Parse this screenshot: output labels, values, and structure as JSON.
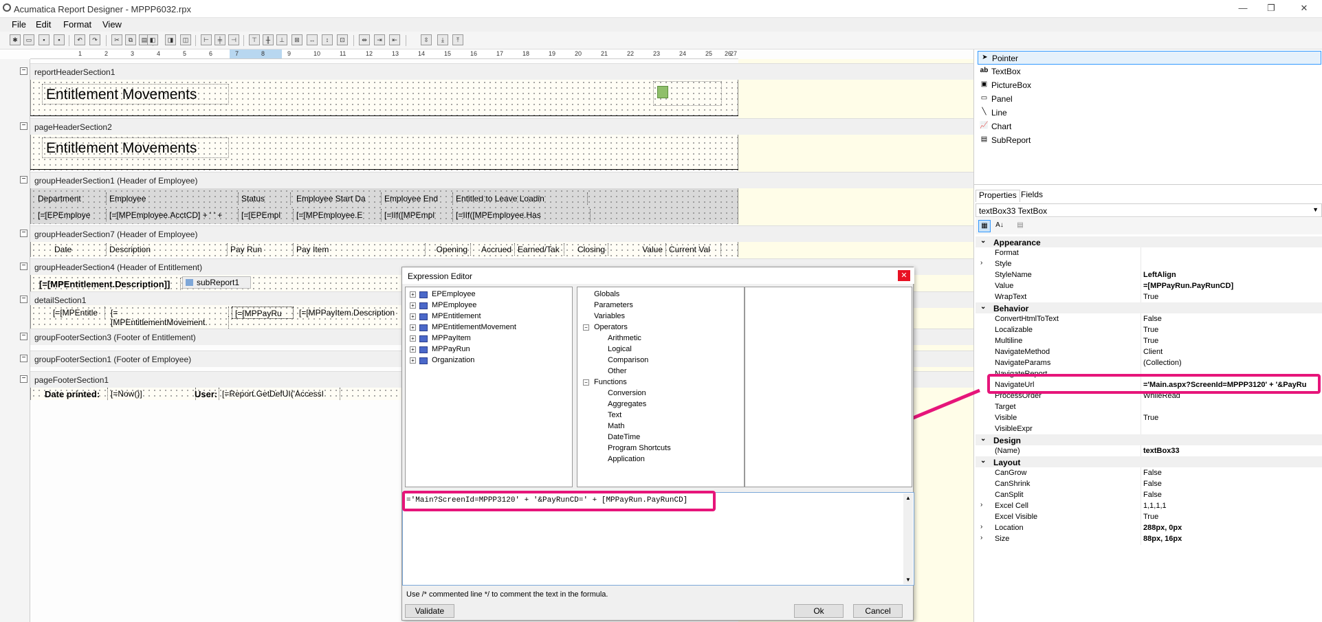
{
  "window": {
    "title": "Acumatica Report Designer - MPPP6032.rpx"
  },
  "menu": [
    "File",
    "Edit",
    "Format",
    "View"
  ],
  "ruler": [
    "1",
    "2",
    "3",
    "4",
    "5",
    "6",
    "7",
    "8",
    "9",
    "10",
    "11",
    "12",
    "13",
    "14",
    "15",
    "16",
    "17",
    "18",
    "19",
    "20",
    "21",
    "22",
    "23",
    "24",
    "25",
    "26",
    "27"
  ],
  "sections": {
    "s1": "reportHeaderSection1",
    "s2": "pageHeaderSection2",
    "s3": "groupHeaderSection1 (Header of Employee)",
    "s4": "groupHeaderSection7 (Header of Employee)",
    "s5": "groupHeaderSection4 (Header of Entitlement)",
    "s6": "detailSection1",
    "s7": "groupFooterSection3 (Footer of Entitlement)",
    "s8": "groupFooterSection1 (Footer of Employee)",
    "s9": "pageFooterSection1"
  },
  "report": {
    "title1": "Entitlement Movements",
    "title2": "Entitlement Movements",
    "hdr": [
      "Department",
      "Employee",
      "Status",
      "Employee Start Da",
      "Employee End",
      "Entitled to Leave Loadin"
    ],
    "hdrvals": [
      "[=[EPEmploye",
      "[=[MPEmployee.AcctCD] + ' ' +",
      "[=[EPEmpl",
      "[=[MPEmployee.E",
      "[=IIf([MPEmpl",
      "[=IIf([MPEmployee.Has"
    ],
    "cols": [
      "Date",
      "Description",
      "Pay Run",
      "Pay Item",
      "Opening",
      "Accrued",
      "Earned/Tak",
      "Closing",
      "Value",
      "Current Val"
    ],
    "ent_desc": "[=[MPEntitlement.Description]]",
    "subreport": "subReport1",
    "detail": [
      "[=[MPEntitle",
      "[=",
      "[MPEntitlementMovement.",
      "[=[MPPayRu",
      "[=[MPPayItem.Description"
    ],
    "footer": {
      "date_label": "Date printed:",
      "date_val": "[=Now()]",
      "user_label": "User:",
      "user_val": "[=Report.GetDefUI('AccessI"
    }
  },
  "toolbox": [
    {
      "icon": "pointer-icon",
      "label": "Pointer"
    },
    {
      "icon": "textbox-icon",
      "label": "TextBox"
    },
    {
      "icon": "picturebox-icon",
      "label": "PictureBox"
    },
    {
      "icon": "panel-icon",
      "label": "Panel"
    },
    {
      "icon": "line-icon",
      "label": "Line"
    },
    {
      "icon": "chart-icon",
      "label": "Chart"
    },
    {
      "icon": "subreport-icon",
      "label": "SubReport"
    }
  ],
  "props": {
    "tabs": [
      "Properties",
      "Fields"
    ],
    "object": "textBox33 TextBox",
    "rows": [
      {
        "t": "cat",
        "n": "Appearance"
      },
      {
        "n": "Format",
        "v": ""
      },
      {
        "n": "Style",
        "v": "",
        "exp": true
      },
      {
        "n": "StyleName",
        "v": "LeftAlign",
        "b": true
      },
      {
        "n": "Value",
        "v": "=[MPPayRun.PayRunCD]",
        "b": true
      },
      {
        "n": "WrapText",
        "v": "True"
      },
      {
        "t": "cat",
        "n": "Behavior"
      },
      {
        "n": "ConvertHtmlToText",
        "v": "False"
      },
      {
        "n": "Localizable",
        "v": "True"
      },
      {
        "n": "Multiline",
        "v": "True"
      },
      {
        "n": "NavigateMethod",
        "v": "Client"
      },
      {
        "n": "NavigateParams",
        "v": "(Collection)"
      },
      {
        "n": "NavigateReport",
        "v": ""
      },
      {
        "n": "NavigateUrl",
        "v": "='Main.aspx?ScreenId=MPPP3120' + '&PayRu",
        "b": true
      },
      {
        "n": "ProcessOrder",
        "v": "WhileRead"
      },
      {
        "n": "Target",
        "v": ""
      },
      {
        "n": "Visible",
        "v": "True"
      },
      {
        "n": "VisibleExpr",
        "v": ""
      },
      {
        "t": "cat",
        "n": "Design"
      },
      {
        "n": "(Name)",
        "v": "textBox33",
        "b": true
      },
      {
        "t": "cat",
        "n": "Layout"
      },
      {
        "n": "CanGrow",
        "v": "False"
      },
      {
        "n": "CanShrink",
        "v": "False"
      },
      {
        "n": "CanSplit",
        "v": "False"
      },
      {
        "n": "Excel Cell",
        "v": "1,1,1,1",
        "exp": true
      },
      {
        "n": "Excel Visible",
        "v": "True"
      },
      {
        "n": "Location",
        "v": "288px, 0px",
        "b": true,
        "exp": true
      },
      {
        "n": "Size",
        "v": "88px, 16px",
        "b": true,
        "exp": true
      }
    ]
  },
  "dialog": {
    "title": "Expression Editor",
    "tables": [
      "EPEmployee",
      "MPEmployee",
      "MPEntitlement",
      "MPEntitlementMovement",
      "MPPayItem",
      "MPPayRun",
      "Organization"
    ],
    "tree": [
      {
        "l": "Globals",
        "d": 0
      },
      {
        "l": "Parameters",
        "d": 0
      },
      {
        "l": "Variables",
        "d": 0
      },
      {
        "l": "Operators",
        "d": 0,
        "p": true
      },
      {
        "l": "Arithmetic",
        "d": 1
      },
      {
        "l": "Logical",
        "d": 1
      },
      {
        "l": "Comparison",
        "d": 1
      },
      {
        "l": "Other",
        "d": 1
      },
      {
        "l": "Functions",
        "d": 0,
        "p": true
      },
      {
        "l": "Conversion",
        "d": 1
      },
      {
        "l": "Aggregates",
        "d": 1
      },
      {
        "l": "Text",
        "d": 1
      },
      {
        "l": "Math",
        "d": 1
      },
      {
        "l": "DateTime",
        "d": 1
      },
      {
        "l": "Program Shortcuts",
        "d": 1
      },
      {
        "l": "Application",
        "d": 1
      }
    ],
    "expression": "='Main?ScreenId=MPPP3120' + '&PayRunCD=' + [MPPayRun.PayRunCD]",
    "hint": "Use /* commented line */ to comment the text in the formula.",
    "validate": "Validate",
    "ok": "Ok",
    "cancel": "Cancel"
  },
  "colors": {
    "highlight": "#e6157a"
  }
}
